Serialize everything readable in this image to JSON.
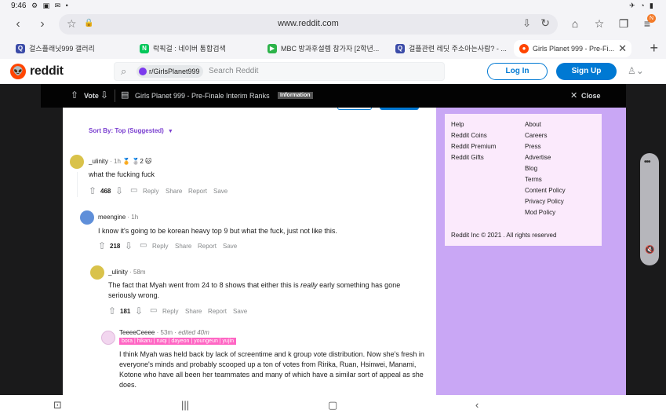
{
  "status": {
    "time": "9:46",
    "left_icons": "⚙ ▣ ✉ •",
    "right_icons": "✈ ◔ ▮"
  },
  "browser": {
    "url": "www.reddit.com",
    "badge": "N",
    "tabs": [
      {
        "label": "걸스플래닛999 갤러리",
        "favicon": "Q",
        "color": "#3b4ba8"
      },
      {
        "label": "락픽걸 : 네이버 통합검색",
        "favicon": "N",
        "color": "#03c75a"
      },
      {
        "label": "MBC 방과후설렘 참가자 [2학년...",
        "favicon": "▶",
        "color": "#2db34a"
      },
      {
        "label": "걸플관련 레딧 주소아는사람? - ...",
        "favicon": "Q",
        "color": "#3b4ba8"
      },
      {
        "label": "Girls Planet 999 - Pre-Fi...",
        "favicon": "●",
        "color": "#ff4500"
      }
    ]
  },
  "header": {
    "logo": "reddit",
    "search_chip": "r/GirlsPlanet999",
    "search_placeholder": "Search Reddit",
    "login": "Log In",
    "signup": "Sign Up"
  },
  "postbar": {
    "vote": "Vote",
    "title": "Girls Planet 999 - Pre-Finale Interim Ranks",
    "flair": "Information",
    "close": "Close"
  },
  "sort": {
    "label": "Sort By: Top (Suggested)"
  },
  "comments": [
    {
      "user": "_ulinity",
      "meta": "· 1h",
      "awards": "🏅 🥈2 🐱",
      "text": "what the fucking fuck",
      "score": "468",
      "avatar_color": "#d9c24a"
    },
    {
      "user": "meengine",
      "meta": "· 1h",
      "text": "I know it's going to be korean heavy top 9 but what the fuck, just not like this.",
      "score": "218",
      "avatar_color": "#5f8fd9"
    },
    {
      "user": "_ulinity",
      "meta": "· 58m",
      "text_a": "The fact that Myah went from 24 to 8 shows that either this is ",
      "text_em": "really",
      "text_b": " early something has gone seriously wrong.",
      "score": "181",
      "avatar_color": "#d9c24a"
    },
    {
      "user": "TeeeeCeeee",
      "meta": "· 53m ·",
      "edited": "edited 40m",
      "flair": "bora | hikaru | ruiqi | dayeon | youngeun | yujin",
      "text": "I think Myah was held back by lack of screentime and k group vote distribution. Now she's fresh in everyone's minds and probably scooped up a ton of votes from Ririka, Ruan, Hsinwei, Manami, Kotone who have all been her teammates and many of which have a similar sort of appeal as she does.",
      "avatar_color": "#f2d6ef"
    }
  ],
  "actions": {
    "reply": "Reply",
    "share": "Share",
    "report": "Report",
    "save": "Save"
  },
  "sidebar": {
    "left_links": [
      "Help",
      "Reddit Coins",
      "Reddit Premium",
      "Reddit Gifts"
    ],
    "right_links": [
      "About",
      "Careers",
      "Press",
      "Advertise",
      "Blog",
      "Terms",
      "Content Policy",
      "Privacy Policy",
      "Mod Policy"
    ],
    "copyright": "Reddit Inc © 2021 . All rights reserved"
  },
  "colors": {
    "accent": "#0079d3",
    "reddit_orange": "#ff4500",
    "community_purple": "#c9a7f5",
    "sort_purple": "#7a3fd0"
  }
}
